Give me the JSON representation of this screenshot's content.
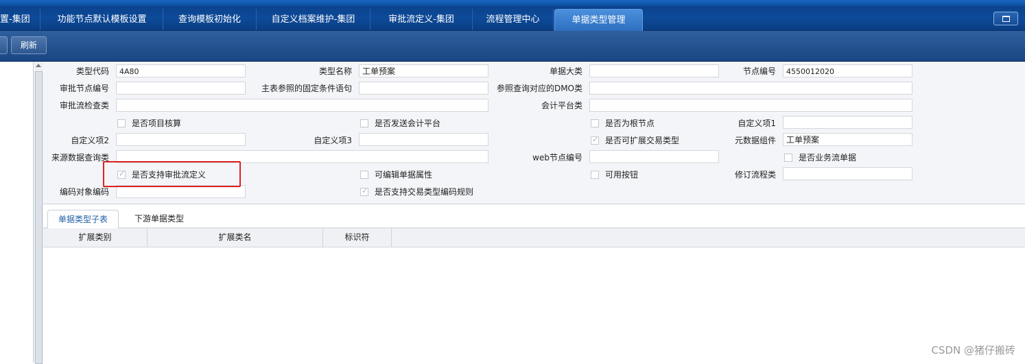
{
  "tabs": [
    {
      "label": "置-集团"
    },
    {
      "label": "功能节点默认模板设置"
    },
    {
      "label": "查询模板初始化"
    },
    {
      "label": "自定义档案维护-集团"
    },
    {
      "label": "审批流定义-集团"
    },
    {
      "label": "流程管理中心"
    },
    {
      "label": "单据类型管理"
    }
  ],
  "toolbar": {
    "refresh_label": "刷新"
  },
  "form": {
    "type_code": {
      "label": "类型代码",
      "value": "4A80"
    },
    "type_name": {
      "label": "类型名称",
      "value": "工单预案"
    },
    "bill_category": {
      "label": "单据大类",
      "value": ""
    },
    "node_code": {
      "label": "节点编号",
      "value": "4550012020"
    },
    "approve_node_code": {
      "label": "审批节点编号",
      "value": ""
    },
    "main_ref_condition": {
      "label": "主表参照的固定条件语句",
      "value": ""
    },
    "ref_query_dmo": {
      "label": "参照查询对应的DMO类",
      "value": ""
    },
    "approve_check_class": {
      "label": "审批流检查类",
      "value": ""
    },
    "accounting_platform_class": {
      "label": "会计平台类",
      "value": ""
    },
    "cb_project_accounting": {
      "label": "是否项目核算",
      "checked": false
    },
    "cb_send_accounting": {
      "label": "是否发送会计平台",
      "checked": false
    },
    "cb_root_node": {
      "label": "是否为根节点",
      "checked": false
    },
    "custom1": {
      "label": "自定义项1",
      "value": ""
    },
    "custom2": {
      "label": "自定义项2",
      "value": ""
    },
    "custom3": {
      "label": "自定义项3",
      "value": ""
    },
    "cb_extend_trade": {
      "label": "是否可扩展交易类型",
      "checked": true
    },
    "metadata_component": {
      "label": "元数据组件",
      "value": "工单预案"
    },
    "source_query_class": {
      "label": "来源数据查询类",
      "value": ""
    },
    "web_node_code": {
      "label": "web节点编号",
      "value": ""
    },
    "cb_business_flow": {
      "label": "是否业务流单据",
      "checked": false
    },
    "cb_support_approve": {
      "label": "是否支持审批流定义",
      "checked": true
    },
    "cb_editable_attr": {
      "label": "可编辑单据属性",
      "checked": false
    },
    "cb_available_button": {
      "label": "可用按钮",
      "checked": false
    },
    "revise_flow_class": {
      "label": "修订流程类",
      "value": ""
    },
    "encode_object": {
      "label": "编码对象编码",
      "value": ""
    },
    "cb_trade_encode_rule": {
      "label": "是否支持交易类型编码规则",
      "checked": true
    }
  },
  "subtabs": [
    {
      "label": "单据类型子表"
    },
    {
      "label": "下游单据类型"
    }
  ],
  "table": {
    "columns": [
      "扩展类别",
      "扩展类名",
      "标识符"
    ]
  },
  "watermark": "CSDN @猪仔搬砖"
}
